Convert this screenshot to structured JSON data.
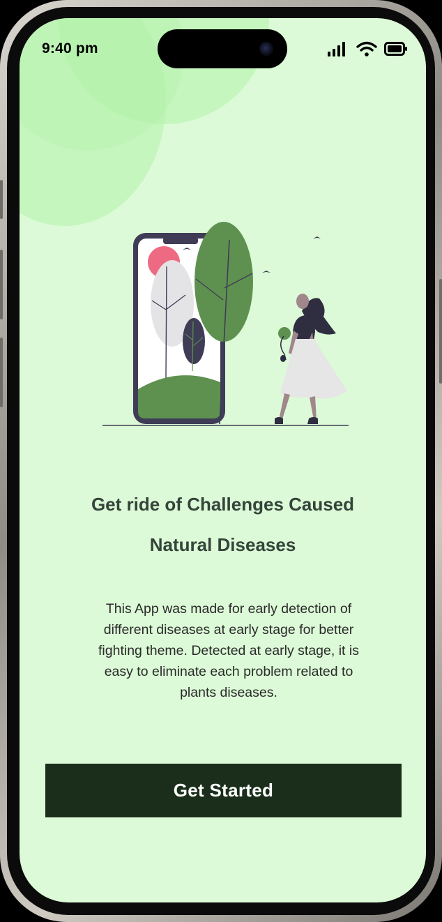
{
  "status_bar": {
    "time": "9:40 pm"
  },
  "onboarding": {
    "headline_line1": "Get ride of Challenges Caused",
    "headline_line2": "Natural Diseases",
    "description": "This App was made for early detection of different diseases at early stage for better fighting theme. Detected at early stage, it is easy to eliminate each problem related to plants diseases.",
    "cta_label": "Get Started"
  },
  "icons": {
    "signal": "cellular-signal-icon",
    "wifi": "wifi-icon",
    "battery": "battery-icon"
  },
  "colors": {
    "background": "#dcfad7",
    "accent_blob": "#b2f2aa",
    "cta_background": "#1a2e1b",
    "cta_text": "#ffffff",
    "headline": "#35443a",
    "body_text": "#2a2a2a",
    "leaf_green": "#5e9150",
    "dark_leaf": "#3b3a4a",
    "sun_pink": "#ee6a82"
  }
}
